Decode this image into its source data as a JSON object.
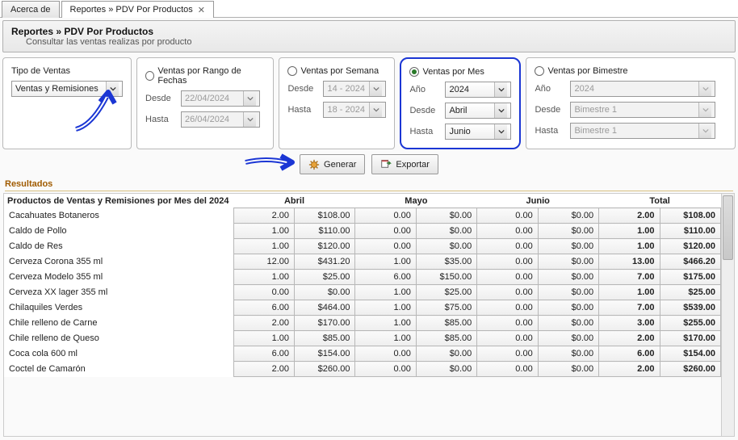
{
  "tabs": {
    "about": "Acerca de",
    "active": "Reportes » PDV Por Productos"
  },
  "header": {
    "title": "Reportes » PDV Por Productos",
    "subtitle": "Consultar las ventas realizas por producto"
  },
  "filters": {
    "tipo": {
      "legend": "Tipo de Ventas",
      "value": "Ventas y Remisiones"
    },
    "rango": {
      "legend": "Ventas por Rango de Fechas",
      "desde_label": "Desde",
      "desde_value": "22/04/2024",
      "hasta_label": "Hasta",
      "hasta_value": "26/04/2024"
    },
    "semana": {
      "legend": "Ventas por Semana",
      "desde_label": "Desde",
      "desde_value": "14 - 2024",
      "hasta_label": "Hasta",
      "hasta_value": "18 - 2024"
    },
    "mes": {
      "legend": "Ventas por Mes",
      "ano_label": "Año",
      "ano_value": "2024",
      "desde_label": "Desde",
      "desde_value": "Abril",
      "hasta_label": "Hasta",
      "hasta_value": "Junio"
    },
    "bimestre": {
      "legend": "Ventas por Bimestre",
      "ano_label": "Año",
      "ano_value": "2024",
      "desde_label": "Desde",
      "desde_value": "Bimestre 1",
      "hasta_label": "Hasta",
      "hasta_value": "Bimestre 1"
    }
  },
  "actions": {
    "generar": "Generar",
    "exportar": "Exportar"
  },
  "results": {
    "label": "Resultados",
    "title": "Productos de Ventas y Remisiones por Mes del 2024",
    "months": [
      "Abril",
      "Mayo",
      "Junio"
    ],
    "total_label": "Total",
    "rows": [
      {
        "name": "Cacahuates Botaneros",
        "m": [
          [
            "2.00",
            "$108.00"
          ],
          [
            "0.00",
            "$0.00"
          ],
          [
            "0.00",
            "$0.00"
          ]
        ],
        "t": [
          "2.00",
          "$108.00"
        ]
      },
      {
        "name": "Caldo de Pollo",
        "m": [
          [
            "1.00",
            "$110.00"
          ],
          [
            "0.00",
            "$0.00"
          ],
          [
            "0.00",
            "$0.00"
          ]
        ],
        "t": [
          "1.00",
          "$110.00"
        ]
      },
      {
        "name": "Caldo de Res",
        "m": [
          [
            "1.00",
            "$120.00"
          ],
          [
            "0.00",
            "$0.00"
          ],
          [
            "0.00",
            "$0.00"
          ]
        ],
        "t": [
          "1.00",
          "$120.00"
        ]
      },
      {
        "name": "Cerveza Corona 355 ml",
        "m": [
          [
            "12.00",
            "$431.20"
          ],
          [
            "1.00",
            "$35.00"
          ],
          [
            "0.00",
            "$0.00"
          ]
        ],
        "t": [
          "13.00",
          "$466.20"
        ]
      },
      {
        "name": "Cerveza Modelo 355 ml",
        "m": [
          [
            "1.00",
            "$25.00"
          ],
          [
            "6.00",
            "$150.00"
          ],
          [
            "0.00",
            "$0.00"
          ]
        ],
        "t": [
          "7.00",
          "$175.00"
        ]
      },
      {
        "name": "Cerveza XX lager 355 ml",
        "m": [
          [
            "0.00",
            "$0.00"
          ],
          [
            "1.00",
            "$25.00"
          ],
          [
            "0.00",
            "$0.00"
          ]
        ],
        "t": [
          "1.00",
          "$25.00"
        ]
      },
      {
        "name": "Chilaquiles Verdes",
        "m": [
          [
            "6.00",
            "$464.00"
          ],
          [
            "1.00",
            "$75.00"
          ],
          [
            "0.00",
            "$0.00"
          ]
        ],
        "t": [
          "7.00",
          "$539.00"
        ]
      },
      {
        "name": "Chile relleno de Carne",
        "m": [
          [
            "2.00",
            "$170.00"
          ],
          [
            "1.00",
            "$85.00"
          ],
          [
            "0.00",
            "$0.00"
          ]
        ],
        "t": [
          "3.00",
          "$255.00"
        ]
      },
      {
        "name": "Chile relleno de Queso",
        "m": [
          [
            "1.00",
            "$85.00"
          ],
          [
            "1.00",
            "$85.00"
          ],
          [
            "0.00",
            "$0.00"
          ]
        ],
        "t": [
          "2.00",
          "$170.00"
        ]
      },
      {
        "name": "Coca cola 600 ml",
        "m": [
          [
            "6.00",
            "$154.00"
          ],
          [
            "0.00",
            "$0.00"
          ],
          [
            "0.00",
            "$0.00"
          ]
        ],
        "t": [
          "6.00",
          "$154.00"
        ]
      },
      {
        "name": "Coctel de Camarón",
        "m": [
          [
            "2.00",
            "$260.00"
          ],
          [
            "0.00",
            "$0.00"
          ],
          [
            "0.00",
            "$0.00"
          ]
        ],
        "t": [
          "2.00",
          "$260.00"
        ]
      }
    ]
  },
  "chart_data": {
    "type": "table",
    "title": "Productos de Ventas y Remisiones por Mes del 2024",
    "columns": [
      "Producto",
      "Abril Qty",
      "Abril $",
      "Mayo Qty",
      "Mayo $",
      "Junio Qty",
      "Junio $",
      "Total Qty",
      "Total $"
    ],
    "rows": [
      [
        "Cacahuates Botaneros",
        2.0,
        108.0,
        0.0,
        0.0,
        0.0,
        0.0,
        2.0,
        108.0
      ],
      [
        "Caldo de Pollo",
        1.0,
        110.0,
        0.0,
        0.0,
        0.0,
        0.0,
        1.0,
        110.0
      ],
      [
        "Caldo de Res",
        1.0,
        120.0,
        0.0,
        0.0,
        0.0,
        0.0,
        1.0,
        120.0
      ],
      [
        "Cerveza Corona 355 ml",
        12.0,
        431.2,
        1.0,
        35.0,
        0.0,
        0.0,
        13.0,
        466.2
      ],
      [
        "Cerveza Modelo 355 ml",
        1.0,
        25.0,
        6.0,
        150.0,
        0.0,
        0.0,
        7.0,
        175.0
      ],
      [
        "Cerveza XX lager 355 ml",
        0.0,
        0.0,
        1.0,
        25.0,
        0.0,
        0.0,
        1.0,
        25.0
      ],
      [
        "Chilaquiles Verdes",
        6.0,
        464.0,
        1.0,
        75.0,
        0.0,
        0.0,
        7.0,
        539.0
      ],
      [
        "Chile relleno de Carne",
        2.0,
        170.0,
        1.0,
        85.0,
        0.0,
        0.0,
        3.0,
        255.0
      ],
      [
        "Chile relleno de Queso",
        1.0,
        85.0,
        1.0,
        85.0,
        0.0,
        0.0,
        2.0,
        170.0
      ],
      [
        "Coca cola 600 ml",
        6.0,
        154.0,
        0.0,
        0.0,
        0.0,
        0.0,
        6.0,
        154.0
      ],
      [
        "Coctel de Camarón",
        2.0,
        260.0,
        0.0,
        0.0,
        0.0,
        0.0,
        2.0,
        260.0
      ]
    ]
  }
}
